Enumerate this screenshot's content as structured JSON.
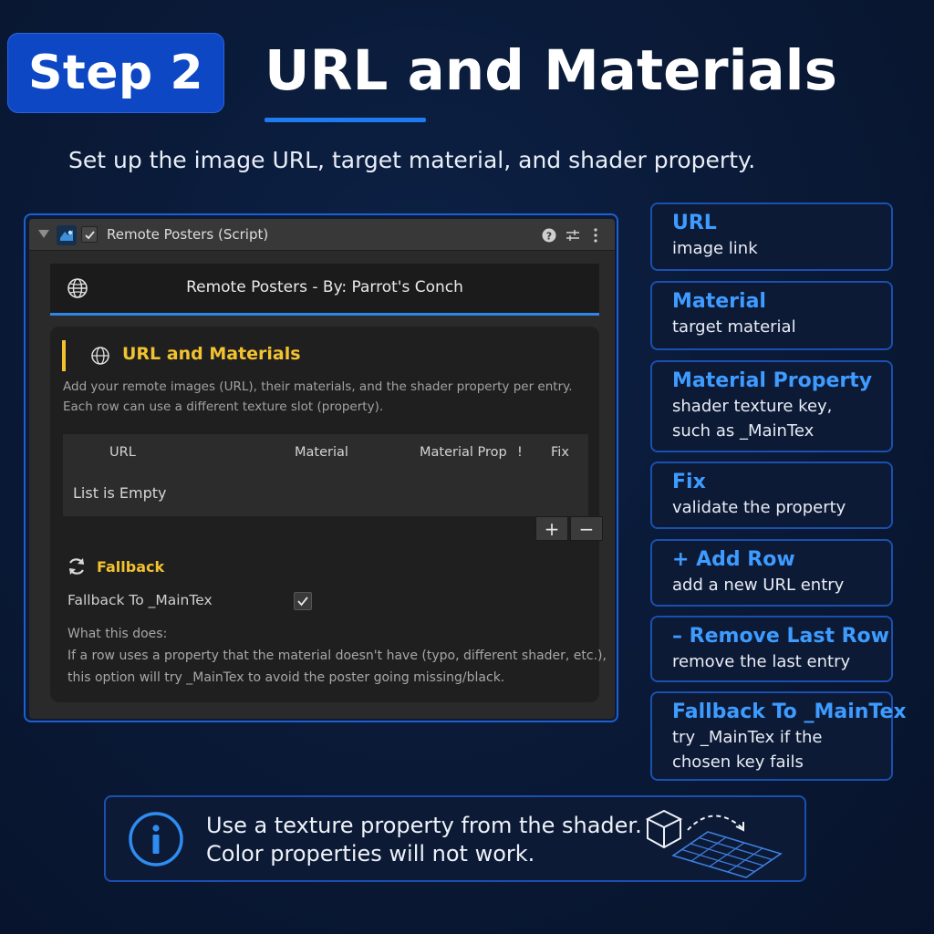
{
  "header": {
    "step_label": "Step 2",
    "title": "URL and Materials",
    "subtitle": "Set up the image URL, target material, and shader property."
  },
  "inspector": {
    "component_title": "Remote Posters (Script)",
    "banner_title": "Remote Posters - By: Parrot's Conch",
    "section": {
      "title": "URL and Materials",
      "description_line1": "Add your remote images (URL), their materials, and the shader property per entry.",
      "description_line2": "Each row can use a different texture slot (property)."
    },
    "table": {
      "columns": [
        "URL",
        "Material",
        "Material Prop",
        "!",
        "Fix"
      ],
      "empty_text": "List is Empty",
      "add_label": "+",
      "remove_label": "−"
    },
    "fallback": {
      "title": "Fallback",
      "toggle_label": "Fallback To _MainTex",
      "toggle_checked": true,
      "help_title": "What this does:",
      "help_line1": "If a row uses a property that the material doesn't have (typo, different shader, etc.),",
      "help_line2": "this option will try _MainTex to avoid the poster going missing/black."
    }
  },
  "info_cards": [
    {
      "title": "URL",
      "desc": [
        "image link"
      ]
    },
    {
      "title": "Material",
      "desc": [
        "target material"
      ]
    },
    {
      "title": "Material Property",
      "desc": [
        "shader texture key,",
        "such as _MainTex"
      ]
    },
    {
      "title": "Fix",
      "desc": [
        "validate the property"
      ]
    },
    {
      "title": "+ Add Row",
      "desc": [
        "add a new URL entry"
      ]
    },
    {
      "title": "– Remove Last Row",
      "desc": [
        "remove the last entry"
      ]
    },
    {
      "title": "Fallback To _MainTex",
      "desc": [
        "try _MainTex if the",
        "chosen key fails"
      ]
    }
  ],
  "tip": {
    "line1": "Use a texture property from the shader.",
    "line2": "Color properties will not work."
  },
  "colors": {
    "accent_blue": "#3e9bff",
    "badge_blue": "#0d47c4",
    "section_yellow": "#f2c230",
    "background": "#0a1a38"
  },
  "icons": [
    "globe-icon",
    "refresh-icon",
    "help-icon",
    "settings-sliders-icon",
    "more-vertical-icon",
    "info-icon",
    "cube-icon",
    "texture-grid-icon",
    "checkmark-icon",
    "foldout-arrow-icon"
  ]
}
